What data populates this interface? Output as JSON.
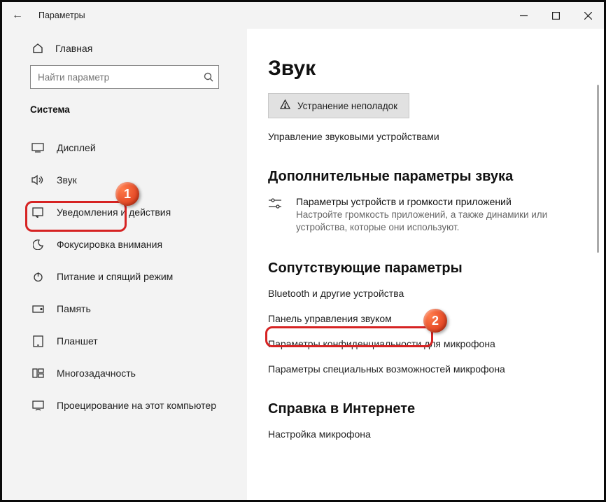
{
  "window": {
    "title": "Параметры",
    "back": "←"
  },
  "sidebar": {
    "home_label": "Главная",
    "search_placeholder": "Найти параметр",
    "section_title": "Система",
    "items": {
      "display": "Дисплей",
      "sound": "Звук",
      "notifications": "Уведомления и действия",
      "focus": "Фокусировка внимания",
      "power": "Питание и спящий режим",
      "storage": "Память",
      "tablet": "Планшет",
      "multitask": "Многозадачность",
      "projecting": "Проецирование на этот компьютер"
    }
  },
  "main": {
    "title": "Звук",
    "troubleshoot_label": "Устранение неполадок",
    "manage_devices_link": "Управление звуковыми устройствами",
    "advanced_heading": "Дополнительные параметры звука",
    "app_volume_title": "Параметры устройств и громкости приложений",
    "app_volume_desc": "Настройте громкость приложений, а также динамики или устройства, которые они используют.",
    "related_heading": "Сопутствующие параметры",
    "related": {
      "bluetooth": "Bluetooth и другие устройства",
      "sound_panel": "Панель управления звуком",
      "mic_privacy": "Параметры конфиденциальности для микрофона",
      "mic_ease": "Параметры специальных возможностей микрофона"
    },
    "help_heading": "Справка в Интернете",
    "help_link": "Настройка микрофона"
  },
  "annotations": {
    "badge1": "1",
    "badge2": "2"
  }
}
